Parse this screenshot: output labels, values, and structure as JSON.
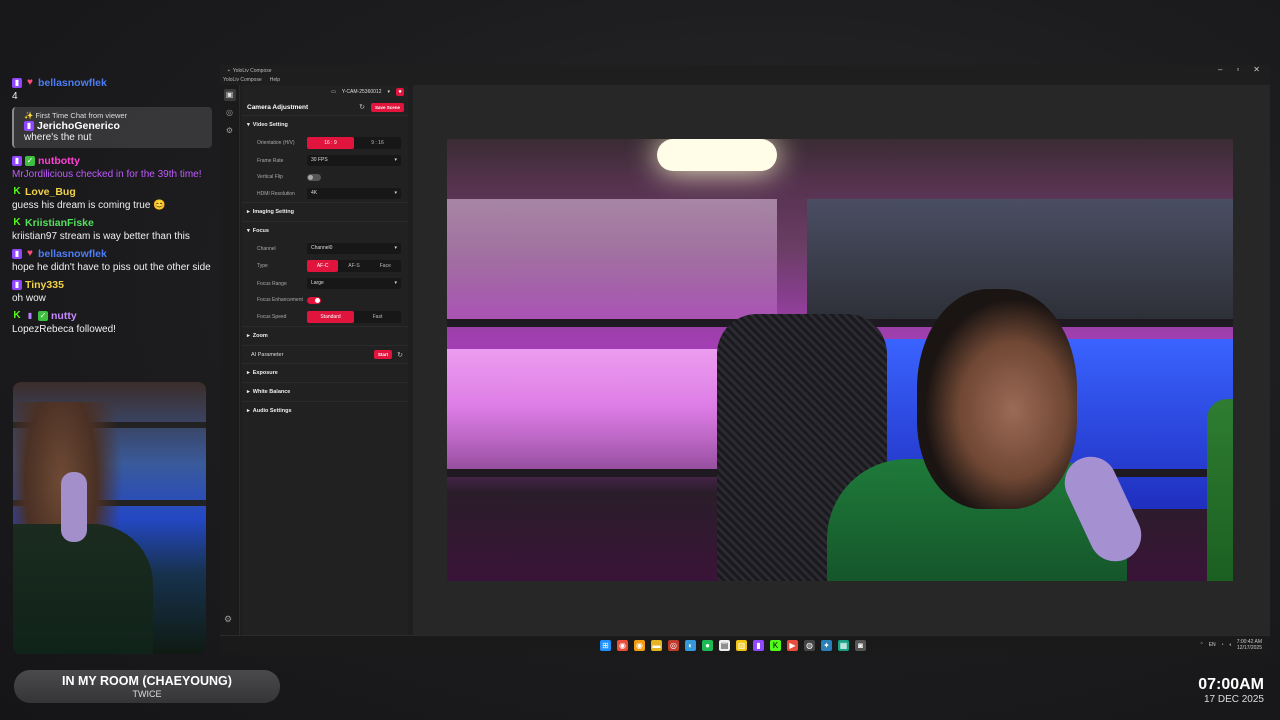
{
  "chat": {
    "messages": [
      {
        "user": "bellasnowflek",
        "user_color": "#4d7df5",
        "text": "4"
      },
      {
        "first_time_title": "✨ First Time Chat from viewer",
        "user": "JerichoGenerico",
        "user_color": "#ffffff",
        "text": "where's the nut"
      },
      {
        "user": "nutbotty",
        "user_color": "#ff3fd6",
        "system": "MrJordilicious checked in for the 39th time!"
      },
      {
        "user": "Love_Bug",
        "user_color": "#f2d14a",
        "text": "guess his dream is coming true 😊"
      },
      {
        "user": "KriistianFiske",
        "user_color": "#53e05b",
        "text": "kriistian97 stream is way better than this"
      },
      {
        "user": "bellasnowflek",
        "user_color": "#4d7df5",
        "text": "hope he didn't have to piss out the other side"
      },
      {
        "user": "Tiny335",
        "user_color": "#f2d14a",
        "text": "oh wow"
      },
      {
        "user": "nutty",
        "user_color": "#c58bff",
        "text": "LopezRebeca followed!"
      }
    ]
  },
  "now_playing": {
    "title": "IN MY ROOM (CHAEYOUNG)",
    "artist": "TWICE"
  },
  "clock": {
    "time": "07:00AM",
    "date": "17 DEC 2025"
  },
  "app": {
    "title": "YoloLiv Compose",
    "menu": [
      "YoloLiv Compose",
      "Help"
    ],
    "device": "Y-CAM-25360012",
    "panel_title": "Camera Adjustment",
    "save_scene": "Save Scene",
    "sections": {
      "video_setting": "Video Setting",
      "imaging_setting": "Imaging Setting",
      "focus": "Focus",
      "zoom": "Zoom",
      "ai_parameter": "AI Parameter",
      "exposure": "Exposure",
      "white_balance": "White Balance",
      "audio_settings": "Audio Settings"
    },
    "video": {
      "orientation_label": "Orientation (H/V)",
      "orientation_options": [
        "16 : 9",
        "9 : 16"
      ],
      "frame_rate_label": "Frame Rate",
      "frame_rate_value": "30 FPS",
      "vertical_flip_label": "Vertical Flip",
      "hdmi_label": "HDMI Resolution",
      "hdmi_value": "4K"
    },
    "focus": {
      "channel_label": "Channel",
      "channel_value": "Channel0",
      "type_label": "Type",
      "type_options": [
        "AF-C",
        "AF-S",
        "Face"
      ],
      "range_label": "Focus Range",
      "range_value": "Large",
      "enhancement_label": "Focus Enhancement",
      "speed_label": "Focus Speed",
      "speed_options": [
        "Standard",
        "Fast"
      ]
    },
    "ai_start": "Start"
  },
  "tray": {
    "lang": "EN",
    "time": "7:00:42 AM",
    "date": "12/17/2025"
  },
  "colors": {
    "accent": "#e0143c"
  }
}
